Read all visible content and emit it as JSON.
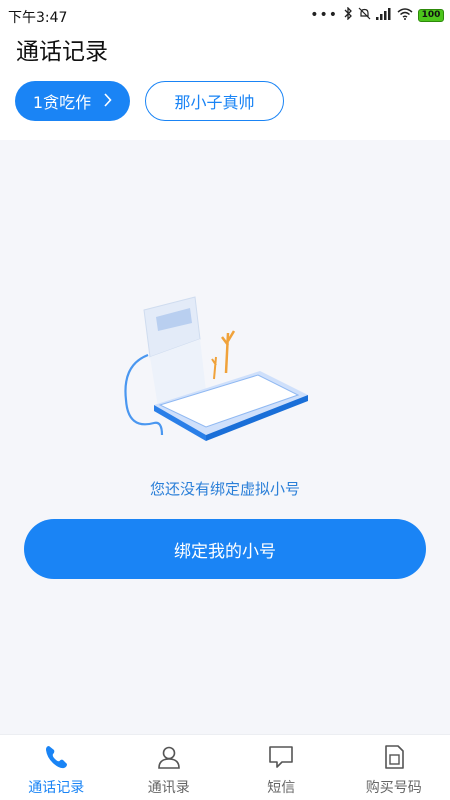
{
  "status_bar": {
    "time": "下午3:47",
    "battery": "100"
  },
  "header": {
    "title": "通话记录"
  },
  "numbers": [
    {
      "label": "1贪吃作",
      "selected": true
    },
    {
      "label": "那小子真帅",
      "selected": false
    }
  ],
  "empty_state": {
    "message": "您还没有绑定虚拟小号",
    "button_label": "绑定我的小号"
  },
  "tabs": [
    {
      "label": "通话记录",
      "icon": "phone-icon",
      "active": true
    },
    {
      "label": "通讯录",
      "icon": "contacts-icon",
      "active": false
    },
    {
      "label": "短信",
      "icon": "message-icon",
      "active": false
    },
    {
      "label": "购买号码",
      "icon": "sim-card-icon",
      "active": false
    }
  ],
  "colors": {
    "accent": "#1a84f5",
    "background": "#f5f6fa"
  }
}
